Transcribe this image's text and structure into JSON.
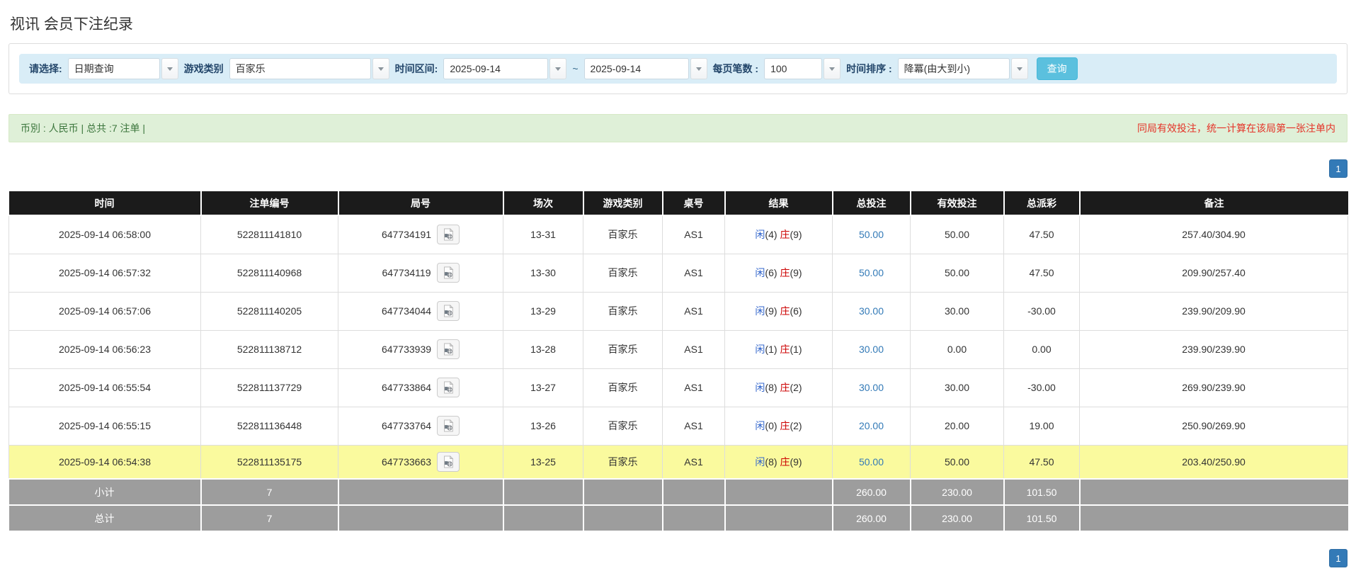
{
  "page": {
    "title": "视讯 会员下注纪录"
  },
  "colors": {
    "accent_blue": "#337ab7",
    "search_button": "#5bc0de",
    "header_bg": "#1b1b1b",
    "highlight_row": "#fafa9e",
    "summary_bg": "#dff0d8",
    "summary_text": "#3c763d",
    "warning_red": "#e53328",
    "player_blue": "#3366cc",
    "banker_red": "#cc0000",
    "negative_red": "#e53333",
    "footer_gray": "#9d9d9d"
  },
  "filters": {
    "select_label": "请选择:",
    "select_value": "日期查询",
    "game_label": "游戏类别",
    "game_value": "百家乐",
    "range_label": "时间区间:",
    "date_from": "2025-09-14",
    "range_sep": "~",
    "date_to": "2025-09-14",
    "page_size_label": "每页笔数 :",
    "page_size_value": "100",
    "sort_label": "时间排序 :",
    "sort_value": "降冪(由大到小)",
    "search_button": "查询"
  },
  "summary": {
    "left": "币別 : 人民币 | 总共 :7 注单 |",
    "right": "同局有效投注，统一计算在该局第一张注单内"
  },
  "pagination": {
    "page": "1"
  },
  "table": {
    "headers": [
      "时间",
      "注单编号",
      "局号",
      "场次",
      "游戏类别",
      "桌号",
      "结果",
      "总投注",
      "有效投注",
      "总派彩",
      "备注"
    ],
    "rows": [
      {
        "time": "2025-09-14 06:58:00",
        "bet_id": "522811141810",
        "round_id": "647734191",
        "session": "13-31",
        "game": "百家乐",
        "table_no": "AS1",
        "player_label": "闲",
        "player_num": "(4)",
        "banker_label": "庄",
        "banker_num": "(9)",
        "total_bet": "50.00",
        "valid_bet": "50.00",
        "payout": "47.50",
        "note": "257.40/304.90"
      },
      {
        "time": "2025-09-14 06:57:32",
        "bet_id": "522811140968",
        "round_id": "647734119",
        "session": "13-30",
        "game": "百家乐",
        "table_no": "AS1",
        "player_label": "闲",
        "player_num": "(6)",
        "banker_label": "庄",
        "banker_num": "(9)",
        "total_bet": "50.00",
        "valid_bet": "50.00",
        "payout": "47.50",
        "note": "209.90/257.40"
      },
      {
        "time": "2025-09-14 06:57:06",
        "bet_id": "522811140205",
        "round_id": "647734044",
        "session": "13-29",
        "game": "百家乐",
        "table_no": "AS1",
        "player_label": "闲",
        "player_num": "(9)",
        "banker_label": "庄",
        "banker_num": "(6)",
        "total_bet": "30.00",
        "valid_bet": "30.00",
        "payout": "-30.00",
        "note": "239.90/209.90"
      },
      {
        "time": "2025-09-14 06:56:23",
        "bet_id": "522811138712",
        "round_id": "647733939",
        "session": "13-28",
        "game": "百家乐",
        "table_no": "AS1",
        "player_label": "闲",
        "player_num": "(1)",
        "banker_label": "庄",
        "banker_num": "(1)",
        "total_bet": "30.00",
        "valid_bet": "0.00",
        "payout": "0.00",
        "note": "239.90/239.90"
      },
      {
        "time": "2025-09-14 06:55:54",
        "bet_id": "522811137729",
        "round_id": "647733864",
        "session": "13-27",
        "game": "百家乐",
        "table_no": "AS1",
        "player_label": "闲",
        "player_num": "(8)",
        "banker_label": "庄",
        "banker_num": "(2)",
        "total_bet": "30.00",
        "valid_bet": "30.00",
        "payout": "-30.00",
        "note": "269.90/239.90"
      },
      {
        "time": "2025-09-14 06:55:15",
        "bet_id": "522811136448",
        "round_id": "647733764",
        "session": "13-26",
        "game": "百家乐",
        "table_no": "AS1",
        "player_label": "闲",
        "player_num": "(0)",
        "banker_label": "庄",
        "banker_num": "(2)",
        "total_bet": "20.00",
        "valid_bet": "20.00",
        "payout": "19.00",
        "note": "250.90/269.90"
      },
      {
        "time": "2025-09-14 06:54:38",
        "bet_id": "522811135175",
        "round_id": "647733663",
        "session": "13-25",
        "game": "百家乐",
        "table_no": "AS1",
        "player_label": "闲",
        "player_num": "(8)",
        "banker_label": "庄",
        "banker_num": "(9)",
        "total_bet": "50.00",
        "valid_bet": "50.00",
        "payout": "47.50",
        "note": "203.40/250.90"
      }
    ],
    "footer": [
      {
        "label": "小计",
        "count": "7",
        "total_bet": "260.00",
        "valid_bet": "230.00",
        "payout": "101.50"
      },
      {
        "label": "总计",
        "count": "7",
        "total_bet": "260.00",
        "valid_bet": "230.00",
        "payout": "101.50"
      }
    ]
  }
}
